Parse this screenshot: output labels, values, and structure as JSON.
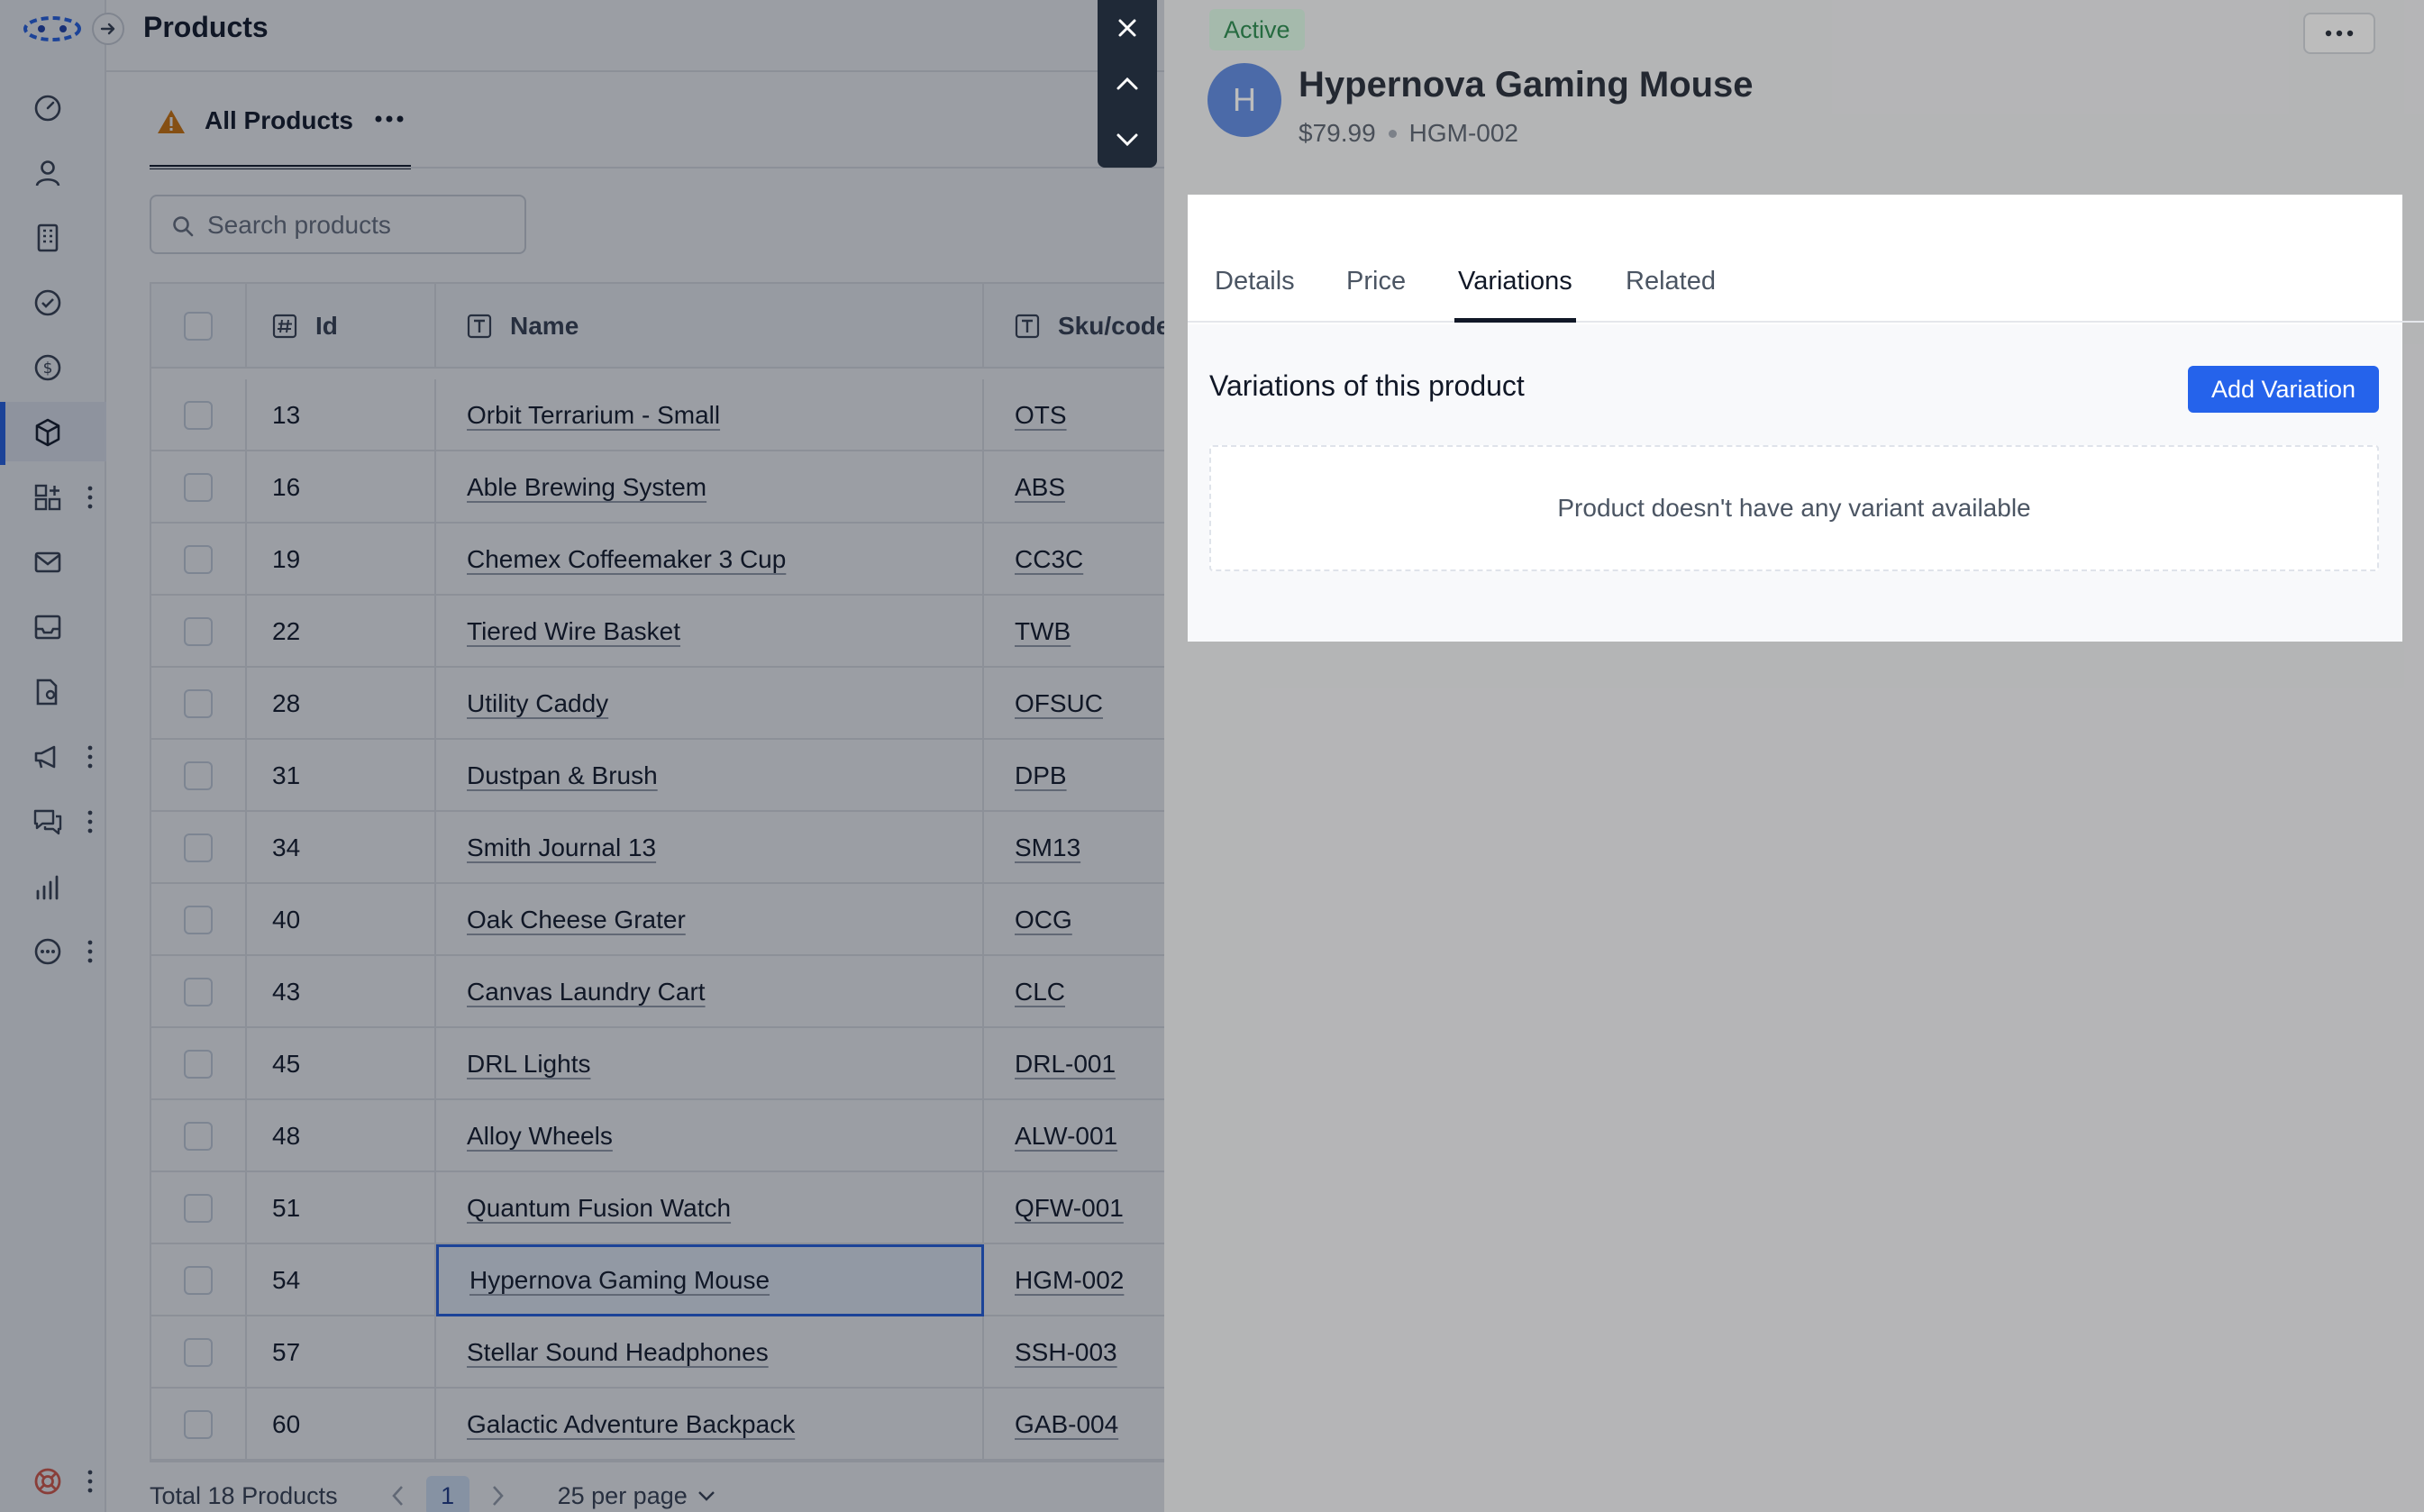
{
  "app": {
    "page_title": "Products"
  },
  "sidebar": {
    "items": [
      {
        "icon": "gauge-icon",
        "kebab": false
      },
      {
        "icon": "user-icon",
        "kebab": false
      },
      {
        "icon": "building-icon",
        "kebab": false
      },
      {
        "icon": "check-circle-icon",
        "kebab": false
      },
      {
        "icon": "dollar-circle-icon",
        "kebab": false
      },
      {
        "icon": "cube-icon",
        "kebab": false,
        "active": true
      },
      {
        "icon": "grid-plus-icon",
        "kebab": true
      },
      {
        "icon": "mail-icon",
        "kebab": false
      },
      {
        "icon": "inbox-icon",
        "kebab": false
      },
      {
        "icon": "document-user-icon",
        "kebab": false
      },
      {
        "icon": "megaphone-icon",
        "kebab": true
      },
      {
        "icon": "chat-icon",
        "kebab": true
      },
      {
        "icon": "bar-chart-icon",
        "kebab": false
      },
      {
        "icon": "more-circle-icon",
        "kebab": true
      }
    ]
  },
  "view_tab": {
    "label": "All Products"
  },
  "search": {
    "placeholder": "Search products",
    "value": ""
  },
  "table": {
    "columns": {
      "id": "Id",
      "name": "Name",
      "sku": "Sku/code"
    },
    "rows": [
      {
        "id": "13",
        "name": "Orbit Terrarium - Small",
        "sku": "OTS"
      },
      {
        "id": "16",
        "name": "Able Brewing System",
        "sku": "ABS"
      },
      {
        "id": "19",
        "name": "Chemex Coffeemaker 3 Cup",
        "sku": "CC3C"
      },
      {
        "id": "22",
        "name": "Tiered Wire Basket",
        "sku": "TWB"
      },
      {
        "id": "28",
        "name": "Utility Caddy",
        "sku": "OFSUC"
      },
      {
        "id": "31",
        "name": "Dustpan & Brush",
        "sku": "DPB"
      },
      {
        "id": "34",
        "name": "Smith Journal 13",
        "sku": "SM13"
      },
      {
        "id": "40",
        "name": "Oak Cheese Grater",
        "sku": "OCG"
      },
      {
        "id": "43",
        "name": "Canvas Laundry Cart",
        "sku": "CLC"
      },
      {
        "id": "45",
        "name": "DRL Lights",
        "sku": "DRL-001"
      },
      {
        "id": "48",
        "name": "Alloy Wheels",
        "sku": "ALW-001"
      },
      {
        "id": "51",
        "name": "Quantum Fusion Watch",
        "sku": "QFW-001"
      },
      {
        "id": "54",
        "name": "Hypernova Gaming Mouse",
        "sku": "HGM-002",
        "selected": true
      },
      {
        "id": "57",
        "name": "Stellar Sound Headphones",
        "sku": "SSH-003"
      },
      {
        "id": "60",
        "name": "Galactic Adventure Backpack",
        "sku": "GAB-004"
      }
    ]
  },
  "footer": {
    "total": "Total 18 Products",
    "current_page": "1",
    "per_page": "25 per page"
  },
  "drawer": {
    "status": "Active",
    "avatar_letter": "H",
    "title": "Hypernova Gaming Mouse",
    "price": "$79.99",
    "sku": "HGM-002",
    "tabs": [
      "Details",
      "Price",
      "Variations",
      "Related"
    ],
    "active_tab": "Variations",
    "variations_title": "Variations of this product",
    "add_variation_label": "Add Variation",
    "empty_message": "Product doesn't have any variant available"
  },
  "colors": {
    "accent": "#2563eb",
    "status_bg": "#dcfce7",
    "status_text": "#15803d",
    "avatar": "#4f7fe0",
    "warning": "#d97706"
  }
}
